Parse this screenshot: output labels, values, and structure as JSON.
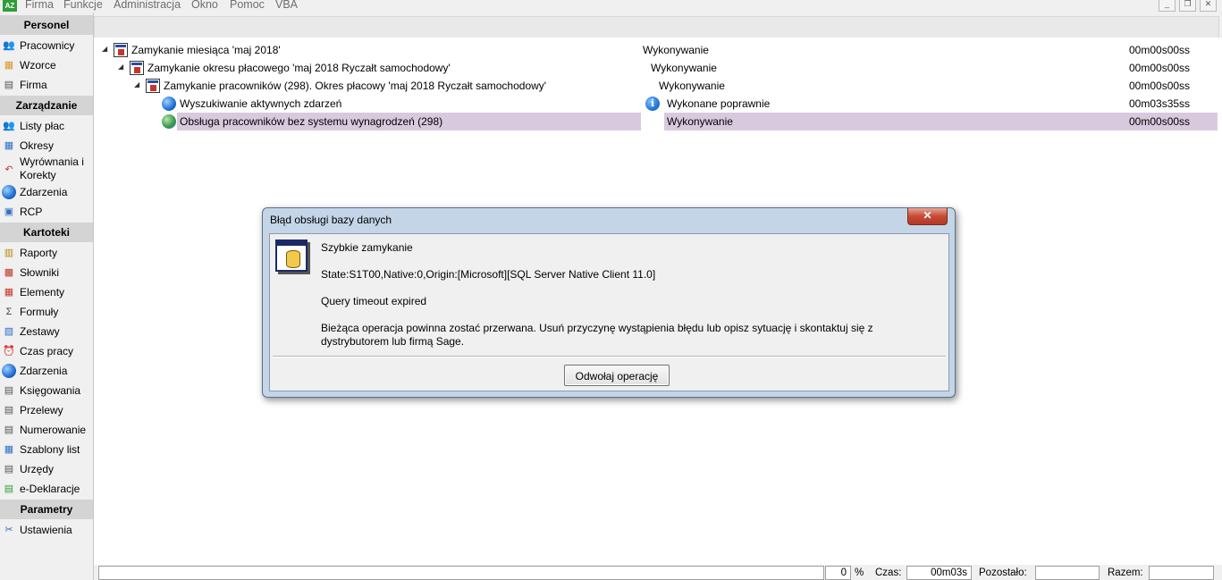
{
  "menubar": {
    "app_icon_text": "AZ",
    "items": [
      "Firma",
      "Funkcje",
      "Administracja",
      "Okno",
      "Pomoc",
      "VBA"
    ]
  },
  "sidebar": {
    "sections": {
      "personel": "Personel",
      "zarzadzanie": "Zarządzanie",
      "kartoteki": "Kartoteki",
      "parametry": "Parametry"
    },
    "personel_items": [
      "Pracownicy",
      "Wzorce",
      "Firma"
    ],
    "zarzadzanie_items": [
      "Listy płac",
      "Okresy",
      "Wyrównania i Korekty",
      "Zdarzenia",
      "RCP"
    ],
    "kartoteki_items": [
      "Raporty",
      "Słowniki",
      "Elementy",
      "Formuły",
      "Zestawy",
      "Czas pracy",
      "Zdarzenia",
      "Księgowania",
      "Przelewy",
      "Numerowanie",
      "Szablony list",
      "Urzędy",
      "e-Deklaracje"
    ],
    "parametry_items": [
      "Ustawienia"
    ]
  },
  "tree": {
    "rows": [
      {
        "name": "Zamykanie miesiąca 'maj 2018'",
        "status": "Wykonywanie",
        "time": "00m00s00ss"
      },
      {
        "name": "Zamykanie okresu płacowego 'maj 2018 Ryczałt samochodowy'",
        "status": "Wykonywanie",
        "time": "00m00s00ss"
      },
      {
        "name": "Zamykanie pracowników (298). Okres płacowy 'maj 2018 Ryczałt samochodowy'",
        "status": "Wykonywanie",
        "time": "00m00s00ss"
      },
      {
        "name": "Wyszukiwanie aktywnych zdarzeń",
        "status": "Wykonane poprawnie",
        "time": "00m03s35ss"
      },
      {
        "name": "Obsługa pracowników bez systemu wynagrodzeń (298)",
        "status": "Wykonywanie",
        "time": "00m00s00ss"
      }
    ]
  },
  "statusbar": {
    "percent_value": "0",
    "percent_sign": "%",
    "czas_label": "Czas:",
    "czas_value": "00m03s",
    "pozostalo_label": "Pozostało:",
    "pozostalo_value": "",
    "razem_label": "Razem:",
    "razem_value": ""
  },
  "dialog": {
    "title": "Błąd obsługi bazy danych",
    "close_glyph": "✕",
    "line1": "Szybkie zamykanie",
    "line2": "State:S1T00,Native:0,Origin:[Microsoft][SQL Server Native Client 11.0]",
    "line3": "Query timeout expired",
    "line4": "Bieżąca operacja powinna zostać przerwana. Usuń przyczynę wystąpienia błędu lub opisz sytuację i skontaktuj się z dystrybutorem lub firmą Sage.",
    "cancel_button": "Odwołaj operację"
  }
}
